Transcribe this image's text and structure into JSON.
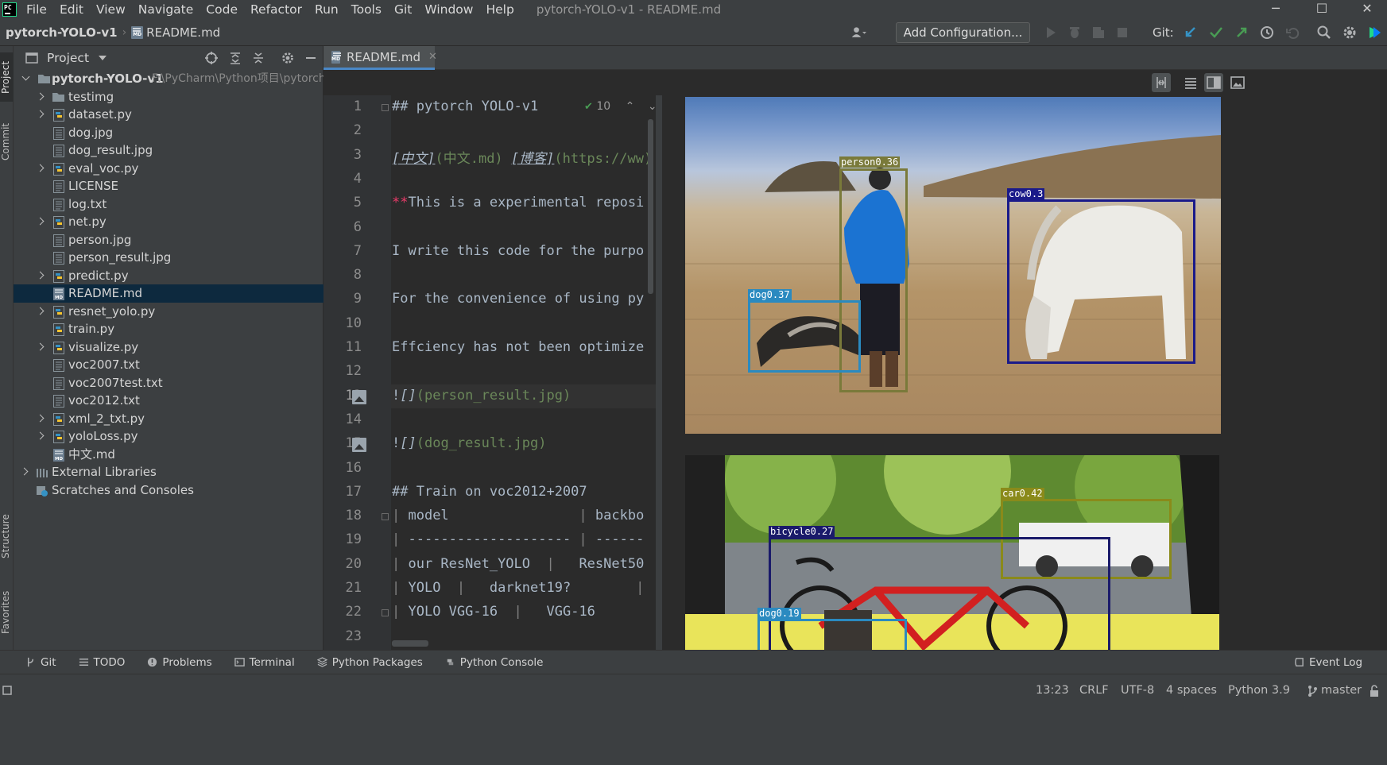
{
  "menu": [
    "File",
    "Edit",
    "View",
    "Navigate",
    "Code",
    "Refactor",
    "Run",
    "Tools",
    "Git",
    "Window",
    "Help"
  ],
  "window_title": "pytorch-YOLO-v1 - README.md",
  "window_controls": {
    "minimize": "─",
    "maximize": "☐",
    "close": "✕"
  },
  "breadcrumb": {
    "project": "pytorch-YOLO-v1",
    "file": "README.md"
  },
  "toolbar": {
    "add_configuration": "Add Configuration...",
    "git_label": "Git:"
  },
  "left_strip": {
    "project": "Project",
    "commit": "Commit",
    "structure": "Structure",
    "favorites": "Favorites"
  },
  "project_panel": {
    "title": "Project",
    "root": {
      "name": "pytorch-YOLO-v1",
      "path": "F:\\PyCharm\\Python项目\\pytorch-"
    },
    "items": [
      {
        "name": "testimg",
        "type": "folder",
        "expandable": true
      },
      {
        "name": "dataset.py",
        "type": "py",
        "expandable": true
      },
      {
        "name": "dog.jpg",
        "type": "img",
        "expandable": false
      },
      {
        "name": "dog_result.jpg",
        "type": "img",
        "expandable": false
      },
      {
        "name": "eval_voc.py",
        "type": "py",
        "expandable": true
      },
      {
        "name": "LICENSE",
        "type": "txt",
        "expandable": false
      },
      {
        "name": "log.txt",
        "type": "txt",
        "expandable": false
      },
      {
        "name": "net.py",
        "type": "py",
        "expandable": true
      },
      {
        "name": "person.jpg",
        "type": "img",
        "expandable": false
      },
      {
        "name": "person_result.jpg",
        "type": "img",
        "expandable": false
      },
      {
        "name": "predict.py",
        "type": "py",
        "expandable": true
      },
      {
        "name": "README.md",
        "type": "md",
        "expandable": false,
        "selected": true
      },
      {
        "name": "resnet_yolo.py",
        "type": "py",
        "expandable": true
      },
      {
        "name": "train.py",
        "type": "py",
        "expandable": false
      },
      {
        "name": "visualize.py",
        "type": "py",
        "expandable": true
      },
      {
        "name": "voc2007.txt",
        "type": "txt",
        "expandable": false
      },
      {
        "name": "voc2007test.txt",
        "type": "txt",
        "expandable": false
      },
      {
        "name": "voc2012.txt",
        "type": "txt",
        "expandable": false
      },
      {
        "name": "xml_2_txt.py",
        "type": "py",
        "expandable": true
      },
      {
        "name": "yoloLoss.py",
        "type": "py",
        "expandable": true
      },
      {
        "name": "中文.md",
        "type": "md",
        "expandable": false
      }
    ],
    "external_libraries": "External Libraries",
    "scratches": "Scratches and Consoles"
  },
  "editor": {
    "tab_label": "README.md",
    "current_line": 13,
    "inspection_count": "10",
    "lines": [
      "## pytorch YOLO-v1",
      "",
      "[中文](中文.md) [博客](https://ww",
      "",
      "**This is a experimental reposi",
      "",
      "I write this code for the purpo",
      "",
      "For the convenience of using py",
      "",
      "Effciency has not been optimize",
      "",
      "![](person_result.jpg)",
      "",
      "![](dog_result.jpg)",
      "",
      "## Train on voc2012+2007",
      "| model                | backbo",
      "| -------------------- | ------",
      "| our ResNet_YOLO  |   ResNet50",
      "| YOLO  |   darknet19?        |",
      "| YOLO VGG-16  |   VGG-16",
      ""
    ]
  },
  "preview": {
    "image1_detections": [
      {
        "label": "person0.36",
        "color": "#7a7a3a"
      },
      {
        "label": "cow0.3",
        "color": "#1a1a8a"
      },
      {
        "label": "dog0.37",
        "color": "#2a8ac0"
      }
    ],
    "image2_detections": [
      {
        "label": "car0.42",
        "color": "#8a8a1a"
      },
      {
        "label": "bicycle0.27",
        "color": "#1a1a6a"
      },
      {
        "label": "dog0.19",
        "color": "#2a8ac0"
      }
    ]
  },
  "bottom_tools": [
    "Git",
    "TODO",
    "Problems",
    "Terminal",
    "Python Packages",
    "Python Console"
  ],
  "event_log": "Event Log",
  "status": {
    "position": "13:23",
    "line_sep": "CRLF",
    "encoding": "UTF-8",
    "indent": "4 spaces",
    "interpreter": "Python 3.9",
    "branch": "master"
  },
  "colors": {
    "accent": "#4a88c7",
    "selection": "#0d293e",
    "background": "#2b2b2b",
    "panel": "#3c3f41"
  }
}
